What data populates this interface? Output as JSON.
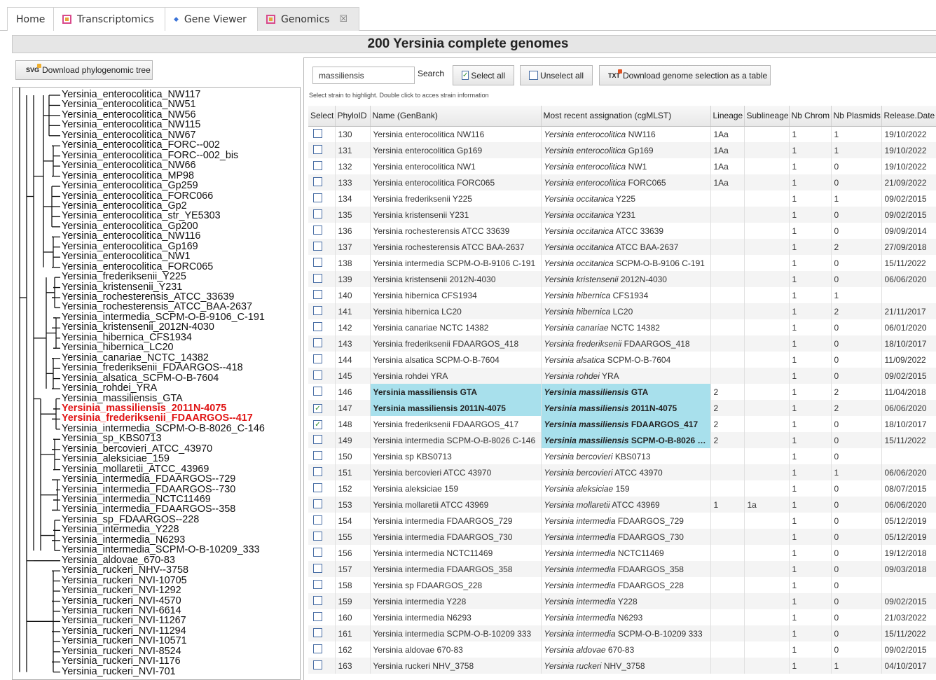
{
  "tabs": [
    {
      "label": "Home",
      "icon": "none"
    },
    {
      "label": "Transcriptomics",
      "icon": "table-icon"
    },
    {
      "label": "Gene Viewer",
      "icon": "diamond-icon"
    },
    {
      "label": "Genomics",
      "icon": "table-icon",
      "close": "☒"
    }
  ],
  "page_title": "200 Yersinia complete genomes",
  "tree": {
    "download_label": "Download phylogenomic tree",
    "download_badge": "SVG",
    "leaves": [
      {
        "label": "Yersinia_enterocolitica_NW117"
      },
      {
        "label": "Yersinia_enterocolitica_NW51"
      },
      {
        "label": "Yersinia_enterocolitica_NW56"
      },
      {
        "label": "Yersinia_enterocolitica_NW115"
      },
      {
        "label": "Yersinia_enterocolitica_NW67"
      },
      {
        "label": "Yersinia_enterocolitica_FORC--002"
      },
      {
        "label": "Yersinia_enterocolitica_FORC--002_bis"
      },
      {
        "label": "Yersinia_enterocolitica_NW66"
      },
      {
        "label": "Yersinia_enterocolitica_MP98"
      },
      {
        "label": "Yersinia_enterocolitica_Gp259"
      },
      {
        "label": "Yersinia_enterocolitica_FORC066"
      },
      {
        "label": "Yersinia_enterocolitica_Gp2"
      },
      {
        "label": "Yersinia_enterocolitica_str_YE5303"
      },
      {
        "label": "Yersinia_enterocolitica_Gp200"
      },
      {
        "label": "Yersinia_enterocolitica_NW116"
      },
      {
        "label": "Yersinia_enterocolitica_Gp169"
      },
      {
        "label": "Yersinia_enterocolitica_NW1"
      },
      {
        "label": "Yersinia_enterocolitica_FORC065"
      },
      {
        "label": "Yersinia_frederiksenii_Y225"
      },
      {
        "label": "Yersinia_kristensenii_Y231"
      },
      {
        "label": "Yersinia_rochesterensis_ATCC_33639"
      },
      {
        "label": "Yersinia_rochesterensis_ATCC_BAA-2637"
      },
      {
        "label": "Yersinia_intermedia_SCPM-O-B-9106_C-191"
      },
      {
        "label": "Yersinia_kristensenii_2012N-4030"
      },
      {
        "label": "Yersinia_hibernica_CFS1934"
      },
      {
        "label": "Yersinia_hibernica_LC20"
      },
      {
        "label": "Yersinia_canariae_NCTC_14382"
      },
      {
        "label": "Yersinia_frederiksenii_FDAARGOS--418"
      },
      {
        "label": "Yersinia_alsatica_SCPM-O-B-7604"
      },
      {
        "label": "Yersinia_rohdei_YRA"
      },
      {
        "label": "Yersinia_massiliensis_GTA"
      },
      {
        "label": "Yersinia_massiliensis_2011N-4075",
        "highlight": true
      },
      {
        "label": "Yersinia_frederiksenii_FDAARGOS--417",
        "highlight": true
      },
      {
        "label": "Yersinia_intermedia_SCPM-O-B-8026_C-146"
      },
      {
        "label": "Yersinia_sp_KBS0713"
      },
      {
        "label": "Yersinia_bercovieri_ATCC_43970"
      },
      {
        "label": "Yersinia_aleksiciae_159"
      },
      {
        "label": "Yersinia_mollaretii_ATCC_43969"
      },
      {
        "label": "Yersinia_intermedia_FDAARGOS--729"
      },
      {
        "label": "Yersinia_intermedia_FDAARGOS--730"
      },
      {
        "label": "Yersinia_intermedia_NCTC11469"
      },
      {
        "label": "Yersinia_intermedia_FDAARGOS--358"
      },
      {
        "label": "Yersinia_sp_FDAARGOS--228"
      },
      {
        "label": "Yersinia_intermedia_Y228"
      },
      {
        "label": "Yersinia_intermedia_N6293"
      },
      {
        "label": "Yersinia_intermedia_SCPM-O-B-10209_333"
      },
      {
        "label": "Yersinia_aldovae_670-83"
      },
      {
        "label": "Yersinia_ruckeri_NHV--3758"
      },
      {
        "label": "Yersinia_ruckeri_NVI-10705"
      },
      {
        "label": "Yersinia_ruckeri_NVI-1292"
      },
      {
        "label": "Yersinia_ruckeri_NVI-4570"
      },
      {
        "label": "Yersinia_ruckeri_NVI-6614"
      },
      {
        "label": "Yersinia_ruckeri_NVI-11267"
      },
      {
        "label": "Yersinia_ruckeri_NVI-11294"
      },
      {
        "label": "Yersinia_ruckeri_NVI-10571"
      },
      {
        "label": "Yersinia_ruckeri_NVI-8524"
      },
      {
        "label": "Yersinia_ruckeri_NVI-1176"
      },
      {
        "label": "Yersinia_ruckeri_NVI-701"
      }
    ]
  },
  "toolbar": {
    "search_value": "massiliensis",
    "search_label": "Search",
    "select_all_label": "Select all",
    "unselect_all_label": "Unselect all",
    "download_table_label": "Download genome selection as a table",
    "download_badge": "TXT",
    "hint": "Select strain to highlight. Double click to acces strain information"
  },
  "table": {
    "columns": [
      "Select",
      "PhyloID",
      "Name (GenBank)",
      "Most recent assignation (cgMLST)",
      "Lineage",
      "Sublineage",
      "Nb Chrom",
      "Nb Plasmids",
      "Release.Date"
    ],
    "rows": [
      {
        "checked": false,
        "id": "130",
        "name": "Yersinia enterocolitica NW116",
        "sp": "Yersinia enterocolitica",
        "strain": "NW116",
        "lineage": "1Aa",
        "sub": "",
        "chrom": "1",
        "plas": "1",
        "date": "19/10/2022"
      },
      {
        "checked": false,
        "id": "131",
        "name": "Yersinia enterocolitica Gp169",
        "sp": "Yersinia enterocolitica",
        "strain": "Gp169",
        "lineage": "1Aa",
        "sub": "",
        "chrom": "1",
        "plas": "1",
        "date": "19/10/2022"
      },
      {
        "checked": false,
        "id": "132",
        "name": "Yersinia enterocolitica NW1",
        "sp": "Yersinia enterocolitica",
        "strain": "NW1",
        "lineage": "1Aa",
        "sub": "",
        "chrom": "1",
        "plas": "0",
        "date": "19/10/2022"
      },
      {
        "checked": false,
        "id": "133",
        "name": "Yersinia enterocolitica FORC065",
        "sp": "Yersinia enterocolitica",
        "strain": "FORC065",
        "lineage": "1Aa",
        "sub": "",
        "chrom": "1",
        "plas": "0",
        "date": "21/09/2022"
      },
      {
        "checked": false,
        "id": "134",
        "name": "Yersinia frederiksenii Y225",
        "sp": "Yersinia occitanica",
        "strain": "Y225",
        "lineage": "",
        "sub": "",
        "chrom": "1",
        "plas": "1",
        "date": "09/02/2015"
      },
      {
        "checked": false,
        "id": "135",
        "name": "Yersinia kristensenii Y231",
        "sp": "Yersinia occitanica",
        "strain": "Y231",
        "lineage": "",
        "sub": "",
        "chrom": "1",
        "plas": "0",
        "date": "09/02/2015"
      },
      {
        "checked": false,
        "id": "136",
        "name": "Yersinia rochesterensis ATCC 33639",
        "sp": "Yersinia occitanica",
        "strain": "ATCC 33639",
        "lineage": "",
        "sub": "",
        "chrom": "1",
        "plas": "0",
        "date": "09/09/2014"
      },
      {
        "checked": false,
        "id": "137",
        "name": "Yersinia rochesterensis ATCC BAA-2637",
        "sp": "Yersinia occitanica",
        "strain": "ATCC BAA-2637",
        "lineage": "",
        "sub": "",
        "chrom": "1",
        "plas": "2",
        "date": "27/09/2018"
      },
      {
        "checked": false,
        "id": "138",
        "name": "Yersinia intermedia SCPM-O-B-9106 C-191",
        "sp": "Yersinia occitanica",
        "strain": "SCPM-O-B-9106 C-191",
        "lineage": "",
        "sub": "",
        "chrom": "1",
        "plas": "0",
        "date": "15/11/2022"
      },
      {
        "checked": false,
        "id": "139",
        "name": "Yersinia kristensenii 2012N-4030",
        "sp": "Yersinia kristensenii",
        "strain": "2012N-4030",
        "lineage": "",
        "sub": "",
        "chrom": "1",
        "plas": "0",
        "date": "06/06/2020"
      },
      {
        "checked": false,
        "id": "140",
        "name": "Yersinia hibernica CFS1934",
        "sp": "Yersinia hibernica",
        "strain": "CFS1934",
        "lineage": "",
        "sub": "",
        "chrom": "1",
        "plas": "1",
        "date": ""
      },
      {
        "checked": false,
        "id": "141",
        "name": "Yersinia hibernica LC20",
        "sp": "Yersinia hibernica",
        "strain": "LC20",
        "lineage": "",
        "sub": "",
        "chrom": "1",
        "plas": "2",
        "date": "21/11/2017"
      },
      {
        "checked": false,
        "id": "142",
        "name": "Yersinia canariae NCTC 14382",
        "sp": "Yersinia canariae",
        "strain": "NCTC 14382",
        "lineage": "",
        "sub": "",
        "chrom": "1",
        "plas": "0",
        "date": "06/01/2020"
      },
      {
        "checked": false,
        "id": "143",
        "name": "Yersinia frederiksenii FDAARGOS_418",
        "sp": "Yersinia frederiksenii",
        "strain": "FDAARGOS_418",
        "lineage": "",
        "sub": "",
        "chrom": "1",
        "plas": "0",
        "date": "18/10/2017"
      },
      {
        "checked": false,
        "id": "144",
        "name": "Yersinia alsatica SCPM-O-B-7604",
        "sp": "Yersinia alsatica",
        "strain": "SCPM-O-B-7604",
        "lineage": "",
        "sub": "",
        "chrom": "1",
        "plas": "0",
        "date": "11/09/2022"
      },
      {
        "checked": false,
        "id": "145",
        "name": "Yersinia rohdei YRA",
        "sp": "Yersinia rohdei",
        "strain": "YRA",
        "lineage": "",
        "sub": "",
        "chrom": "1",
        "plas": "0",
        "date": "09/02/2015"
      },
      {
        "checked": false,
        "id": "146",
        "name": "Yersinia massiliensis GTA",
        "sp": "Yersinia massiliensis",
        "strain": "GTA",
        "lineage": "2",
        "sub": "",
        "chrom": "1",
        "plas": "2",
        "date": "11/04/2018",
        "hl_name": true,
        "hl_assign": true
      },
      {
        "checked": true,
        "id": "147",
        "name": "Yersinia massiliensis 2011N-4075",
        "sp": "Yersinia massiliensis",
        "strain": "2011N-4075",
        "lineage": "2",
        "sub": "",
        "chrom": "1",
        "plas": "2",
        "date": "06/06/2020",
        "hl_name": true,
        "hl_assign": true
      },
      {
        "checked": true,
        "id": "148",
        "name": "Yersinia frederiksenii FDAARGOS_417",
        "sp": "Yersinia massiliensis",
        "strain": "FDAARGOS_417",
        "lineage": "2",
        "sub": "",
        "chrom": "1",
        "plas": "0",
        "date": "18/10/2017",
        "hl_assign": true
      },
      {
        "checked": false,
        "id": "149",
        "name": "Yersinia intermedia SCPM-O-B-8026 C-146",
        "sp": "Yersinia massiliensis",
        "strain": "SCPM-O-B-8026 C-...",
        "lineage": "2",
        "sub": "",
        "chrom": "1",
        "plas": "0",
        "date": "15/11/2022",
        "hl_assign": true
      },
      {
        "checked": false,
        "id": "150",
        "name": "Yersinia sp KBS0713",
        "sp": "Yersinia bercovieri",
        "strain": "KBS0713",
        "lineage": "",
        "sub": "",
        "chrom": "1",
        "plas": "0",
        "date": ""
      },
      {
        "checked": false,
        "id": "151",
        "name": "Yersinia bercovieri ATCC 43970",
        "sp": "Yersinia bercovieri",
        "strain": "ATCC 43970",
        "lineage": "",
        "sub": "",
        "chrom": "1",
        "plas": "1",
        "date": "06/06/2020"
      },
      {
        "checked": false,
        "id": "152",
        "name": "Yersinia aleksiciae 159",
        "sp": "Yersinia aleksiciae",
        "strain": "159",
        "lineage": "",
        "sub": "",
        "chrom": "1",
        "plas": "0",
        "date": "08/07/2015"
      },
      {
        "checked": false,
        "id": "153",
        "name": "Yersinia mollaretii ATCC 43969",
        "sp": "Yersinia mollaretii",
        "strain": "ATCC 43969",
        "lineage": "1",
        "sub": "1a",
        "chrom": "1",
        "plas": "0",
        "date": "06/06/2020"
      },
      {
        "checked": false,
        "id": "154",
        "name": "Yersinia intermedia FDAARGOS_729",
        "sp": "Yersinia intermedia",
        "strain": "FDAARGOS_729",
        "lineage": "",
        "sub": "",
        "chrom": "1",
        "plas": "0",
        "date": "05/12/2019"
      },
      {
        "checked": false,
        "id": "155",
        "name": "Yersinia intermedia FDAARGOS_730",
        "sp": "Yersinia intermedia",
        "strain": "FDAARGOS_730",
        "lineage": "",
        "sub": "",
        "chrom": "1",
        "plas": "0",
        "date": "05/12/2019"
      },
      {
        "checked": false,
        "id": "156",
        "name": "Yersinia intermedia NCTC11469",
        "sp": "Yersinia intermedia",
        "strain": "NCTC11469",
        "lineage": "",
        "sub": "",
        "chrom": "1",
        "plas": "0",
        "date": "19/12/2018"
      },
      {
        "checked": false,
        "id": "157",
        "name": "Yersinia intermedia FDAARGOS_358",
        "sp": "Yersinia intermedia",
        "strain": "FDAARGOS_358",
        "lineage": "",
        "sub": "",
        "chrom": "1",
        "plas": "0",
        "date": "09/03/2018"
      },
      {
        "checked": false,
        "id": "158",
        "name": "Yersinia sp FDAARGOS_228",
        "sp": "Yersinia intermedia",
        "strain": "FDAARGOS_228",
        "lineage": "",
        "sub": "",
        "chrom": "1",
        "plas": "0",
        "date": ""
      },
      {
        "checked": false,
        "id": "159",
        "name": "Yersinia intermedia Y228",
        "sp": "Yersinia intermedia",
        "strain": "Y228",
        "lineage": "",
        "sub": "",
        "chrom": "1",
        "plas": "0",
        "date": "09/02/2015"
      },
      {
        "checked": false,
        "id": "160",
        "name": "Yersinia intermedia N6293",
        "sp": "Yersinia intermedia",
        "strain": "N6293",
        "lineage": "",
        "sub": "",
        "chrom": "1",
        "plas": "0",
        "date": "21/03/2022"
      },
      {
        "checked": false,
        "id": "161",
        "name": "Yersinia intermedia SCPM-O-B-10209 333",
        "sp": "Yersinia intermedia",
        "strain": "SCPM-O-B-10209 333",
        "lineage": "",
        "sub": "",
        "chrom": "1",
        "plas": "0",
        "date": "15/11/2022"
      },
      {
        "checked": false,
        "id": "162",
        "name": "Yersinia aldovae 670-83",
        "sp": "Yersinia aldovae",
        "strain": "670-83",
        "lineage": "",
        "sub": "",
        "chrom": "1",
        "plas": "0",
        "date": "09/02/2015"
      },
      {
        "checked": false,
        "id": "163",
        "name": "Yersinia ruckeri NHV_3758",
        "sp": "Yersinia ruckeri",
        "strain": "NHV_3758",
        "lineage": "",
        "sub": "",
        "chrom": "1",
        "plas": "1",
        "date": "04/10/2017"
      }
    ]
  }
}
